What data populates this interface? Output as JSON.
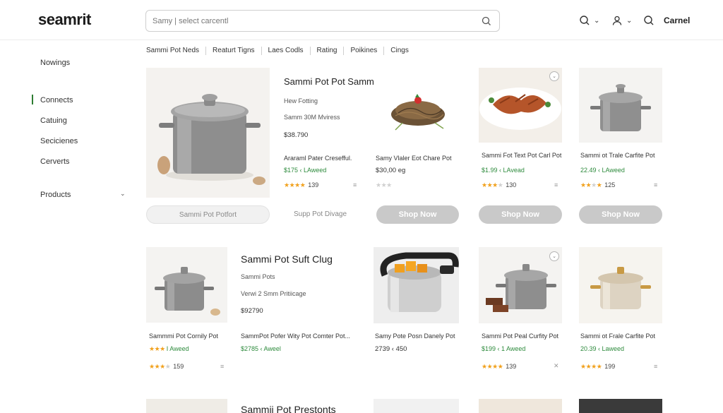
{
  "header": {
    "logo": "seamrit",
    "search_placeholder": "Samy | select carcentl",
    "user_name": "Carnel"
  },
  "sidebar": {
    "items": [
      {
        "label": "Nowings"
      },
      {
        "label": "Connects"
      },
      {
        "label": "Catuing"
      },
      {
        "label": "Secicienes"
      },
      {
        "label": "Cerverts"
      },
      {
        "label": "Products"
      }
    ]
  },
  "filters": [
    "Sammi Pot Neds",
    "Reaturt Tigns",
    "Laes Codls",
    "Rating",
    "Poikines",
    "Cings"
  ],
  "row1": {
    "feature": {
      "title": "Sammi Pot Pot Sammi Polt",
      "sub1": "Hew Fotting",
      "sub2": "Samm 30M Mviress",
      "price": "$38.790",
      "name": "Araraml Pater Cresefful.",
      "green": "$175 ‹ LAweed",
      "rating_count": "139",
      "btn_outline": "Sammi Pot Potfort",
      "btn_text": "Supp Pot Divage"
    },
    "card2": {
      "name": "Samy Vlaler Eot Chare Pot",
      "price": "$30,00 eg",
      "button": "Shop Now"
    },
    "card3": {
      "name": "Sammi Fot Text Pot Carl Pot",
      "green": "$1.99 ‹ LAvead",
      "rating_count": "130",
      "button": "Shop Now"
    },
    "card4": {
      "name": "Sammi ot Trale Carfite Pot",
      "green": "22.49 ‹ LAweed",
      "rating_count": "125",
      "button": "Shop Now"
    }
  },
  "row2": {
    "feature": {
      "title": "Sammi Pot Suft Clug",
      "sub1": "Sammi Pots",
      "sub2": "Verwi 2 Smm Pritiicage",
      "price": "$92790",
      "name": "Sammmi Pot Cornily Pot",
      "green": "I Aweed",
      "rating_count": "159"
    },
    "card_mid": {
      "name": "SammPot Pofer Wity Pot Comter Pot...",
      "green": "$2785 ‹ Aweel"
    },
    "card2": {
      "name": "Samy Pote Posn Danely Pot",
      "price": "2739 ‹ 450"
    },
    "card3": {
      "name": "Sammi Pot Peal Curfity Pot",
      "green": "$199 ‹ 1 Aweed",
      "rating_count": "139"
    },
    "card4": {
      "name": "Sammi ot Frale Carfite Pot",
      "green": "20.39 ‹ Laweed",
      "rating_count": "199"
    }
  },
  "row3": {
    "title": "Sammii Pot Prestonts"
  },
  "icons": {
    "search": "search-icon",
    "account": "user-icon",
    "chevron": "chevron-down-icon",
    "menu": "menu-lines-icon",
    "favorite": "chevron-down-circle-icon"
  },
  "colors": {
    "accent_green": "#2e8b3d",
    "star": "#f1a11d",
    "button_gray": "#c9c9c9"
  }
}
